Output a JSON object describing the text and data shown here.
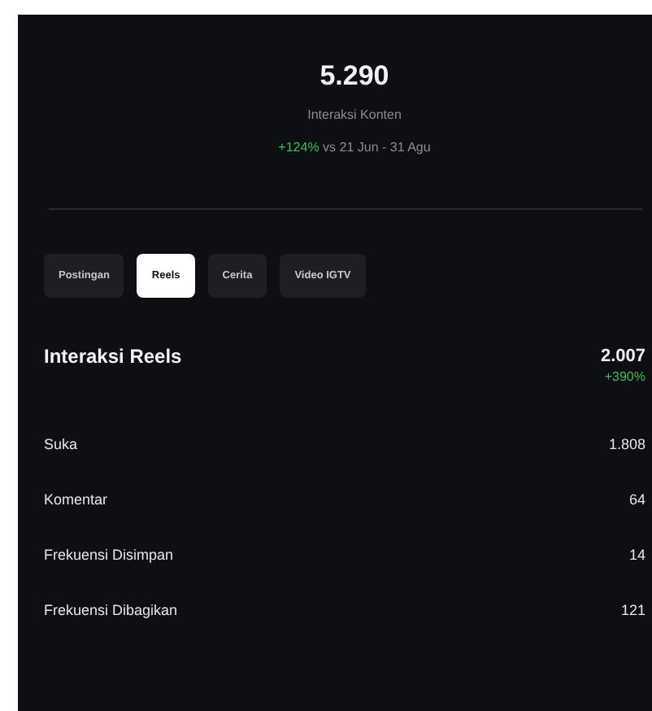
{
  "summary": {
    "value": "5.290",
    "label": "Interaksi Konten",
    "change": "+124%",
    "period": "vs 21 Jun - 31 Agu"
  },
  "tabs": [
    {
      "label": "Postingan",
      "selected": false
    },
    {
      "label": "Reels",
      "selected": true
    },
    {
      "label": "Cerita",
      "selected": false
    },
    {
      "label": "Video IGTV",
      "selected": false
    }
  ],
  "section": {
    "title": "Interaksi Reels",
    "value": "2.007",
    "change": "+390%"
  },
  "metrics": [
    {
      "label": "Suka",
      "value": "1.808"
    },
    {
      "label": "Komentar",
      "value": "64"
    },
    {
      "label": "Frekuensi Disimpan",
      "value": "14"
    },
    {
      "label": "Frekuensi Dibagikan",
      "value": "121"
    }
  ]
}
